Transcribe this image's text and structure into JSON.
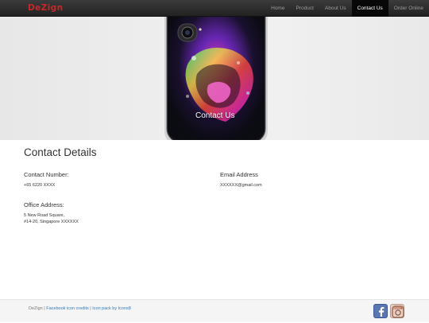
{
  "navbar": {
    "brand": "DeZign",
    "items": [
      {
        "label": "Home",
        "active": false
      },
      {
        "label": "Product",
        "active": false
      },
      {
        "label": "About Us",
        "active": false
      },
      {
        "label": "Contact Us",
        "active": true
      },
      {
        "label": "Order Online",
        "active": false
      }
    ]
  },
  "hero": {
    "caption": "Contact Us"
  },
  "contact": {
    "title": "Contact Details",
    "number_label": "Contact Number:",
    "number_value": "+65 6220 XXXX",
    "email_label": "Email Address",
    "email_value": "XXXXXX@gmail.com",
    "office_label": "Office Address:",
    "office_line1": "5 New Road Square,",
    "office_line2": "#14-20, Singapore XXXXXX"
  },
  "footer": {
    "brand": "DeZign",
    "link1": "Facebook icon credits",
    "link2": "Icon pack by Icons8",
    "separator": " | "
  },
  "colors": {
    "brand": "#c62828",
    "navbar_bg": "#222222",
    "nav_active_bg": "#080808",
    "link": "#337ab7",
    "facebook": "#3b5998"
  },
  "icons": [
    "facebook-icon",
    "instagram-icon"
  ]
}
